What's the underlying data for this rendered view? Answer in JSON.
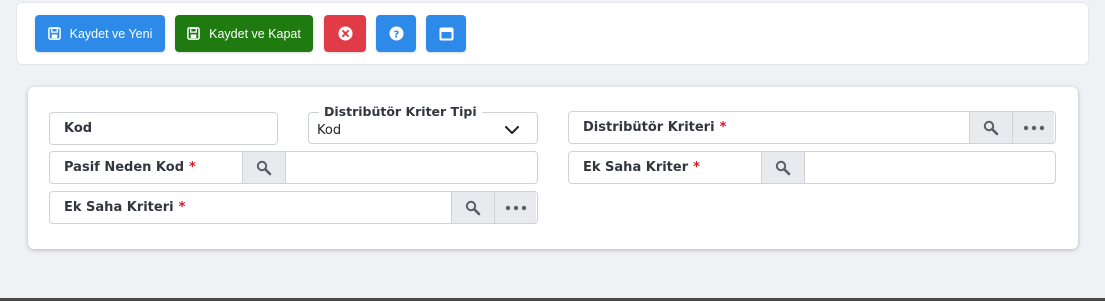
{
  "toolbar": {
    "save_new_label": "Kaydet ve Yeni",
    "save_close_label": "Kaydet ve Kapat",
    "colors": {
      "primary": "#2d8ae8",
      "success": "#1f7a0f",
      "danger": "#e03b47"
    }
  },
  "form": {
    "kod": {
      "label": "Kod",
      "value": ""
    },
    "distributor_kriter_tipi": {
      "legend": "Distribütör Kriter Tipi",
      "value": "Kod"
    },
    "distributor_kriteri": {
      "label": "Distribütör Kriteri",
      "required": "*"
    },
    "pasif_neden_kod": {
      "label": "Pasif Neden Kod",
      "required": "*"
    },
    "ek_saha_kriter": {
      "label": "Ek Saha Kriter",
      "required": "*"
    },
    "ek_saha_kriteri": {
      "label": "Ek Saha Kriteri",
      "required": "*"
    }
  },
  "icons": [
    "save-icon",
    "close-circle-icon",
    "help-icon",
    "window-icon",
    "search-icon",
    "more-icon",
    "chevron-down-icon"
  ]
}
